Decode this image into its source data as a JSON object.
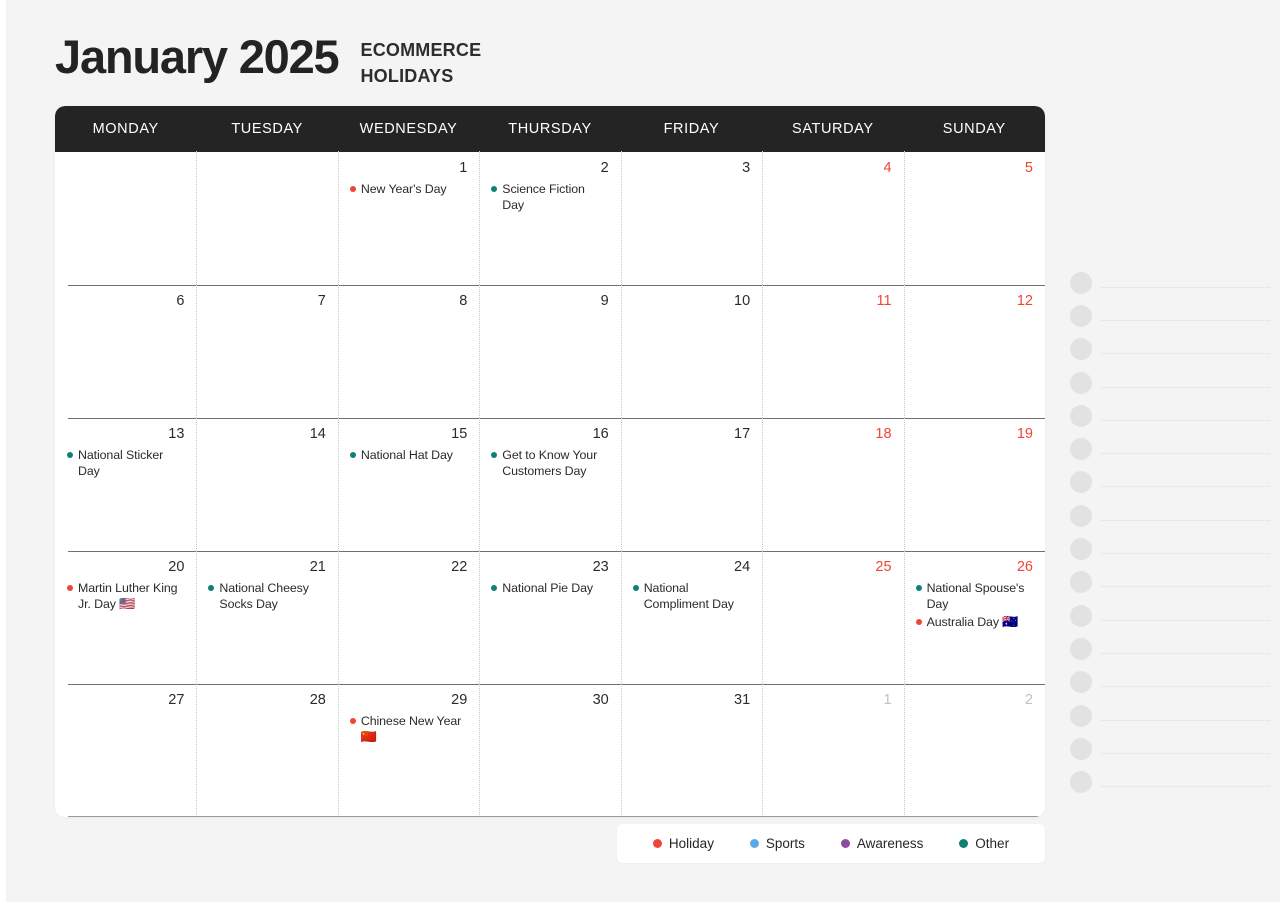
{
  "header": {
    "month_title": "January 2025",
    "subtitle_line1": "ECOMMERCE",
    "subtitle_line2": "HOLIDAYS"
  },
  "weekdays": [
    "MONDAY",
    "TUESDAY",
    "WEDNESDAY",
    "THURSDAY",
    "FRIDAY",
    "SATURDAY",
    "SUNDAY"
  ],
  "colors": {
    "holiday": "#f04438",
    "sports": "#5aa9e6",
    "awareness": "#8e4ca0",
    "other": "#0e8074",
    "header_bg": "#242424",
    "weekend_date": "#f04438",
    "other_month_date": "#c2c2c2",
    "page_bg": "#f4f4f4"
  },
  "legend": [
    {
      "label": "Holiday",
      "color": "#f04438"
    },
    {
      "label": "Sports",
      "color": "#5aa9e6"
    },
    {
      "label": "Awareness",
      "color": "#8e4ca0"
    },
    {
      "label": "Other",
      "color": "#0e8074"
    }
  ],
  "weeks": [
    [
      {
        "date": "",
        "kind": "empty",
        "events": []
      },
      {
        "date": "",
        "kind": "empty",
        "events": []
      },
      {
        "date": "1",
        "kind": "weekday",
        "events": [
          {
            "label": "New Year's Day",
            "category": "Holiday",
            "color": "#f04438",
            "emoji": ""
          }
        ]
      },
      {
        "date": "2",
        "kind": "weekday",
        "events": [
          {
            "label": "Science Fiction Day",
            "category": "Other",
            "color": "#0e8074",
            "emoji": ""
          }
        ]
      },
      {
        "date": "3",
        "kind": "weekday",
        "events": []
      },
      {
        "date": "4",
        "kind": "weekend",
        "events": []
      },
      {
        "date": "5",
        "kind": "weekend",
        "events": []
      }
    ],
    [
      {
        "date": "6",
        "kind": "weekday",
        "events": []
      },
      {
        "date": "7",
        "kind": "weekday",
        "events": []
      },
      {
        "date": "8",
        "kind": "weekday",
        "events": []
      },
      {
        "date": "9",
        "kind": "weekday",
        "events": []
      },
      {
        "date": "10",
        "kind": "weekday",
        "events": []
      },
      {
        "date": "11",
        "kind": "weekend",
        "events": []
      },
      {
        "date": "12",
        "kind": "weekend",
        "events": []
      }
    ],
    [
      {
        "date": "13",
        "kind": "weekday",
        "events": [
          {
            "label": "National Sticker Day",
            "category": "Other",
            "color": "#0e8074",
            "emoji": ""
          }
        ]
      },
      {
        "date": "14",
        "kind": "weekday",
        "events": []
      },
      {
        "date": "15",
        "kind": "weekday",
        "events": [
          {
            "label": "National Hat Day",
            "category": "Other",
            "color": "#0e8074",
            "emoji": ""
          }
        ]
      },
      {
        "date": "16",
        "kind": "weekday",
        "events": [
          {
            "label": "Get to Know Your Customers Day",
            "category": "Other",
            "color": "#0e8074",
            "emoji": ""
          }
        ]
      },
      {
        "date": "17",
        "kind": "weekday",
        "events": []
      },
      {
        "date": "18",
        "kind": "weekend",
        "events": []
      },
      {
        "date": "19",
        "kind": "weekend",
        "events": []
      }
    ],
    [
      {
        "date": "20",
        "kind": "weekday",
        "events": [
          {
            "label": "Martin Luther King Jr. Day",
            "category": "Holiday",
            "color": "#f04438",
            "emoji": "🇺🇸"
          }
        ]
      },
      {
        "date": "21",
        "kind": "weekday",
        "events": [
          {
            "label": "National Cheesy Socks Day",
            "category": "Other",
            "color": "#0e8074",
            "emoji": ""
          }
        ]
      },
      {
        "date": "22",
        "kind": "weekday",
        "events": []
      },
      {
        "date": "23",
        "kind": "weekday",
        "events": [
          {
            "label": "National Pie Day",
            "category": "Other",
            "color": "#0e8074",
            "emoji": ""
          }
        ]
      },
      {
        "date": "24",
        "kind": "weekday",
        "events": [
          {
            "label": "National Compliment Day",
            "category": "Other",
            "color": "#0e8074",
            "emoji": ""
          }
        ]
      },
      {
        "date": "25",
        "kind": "weekend",
        "events": []
      },
      {
        "date": "26",
        "kind": "weekend",
        "events": [
          {
            "label": "National Spouse's Day",
            "category": "Other",
            "color": "#0e8074",
            "emoji": ""
          },
          {
            "label": "Australia Day",
            "category": "Holiday",
            "color": "#f04438",
            "emoji": "🇦🇺"
          }
        ]
      }
    ],
    [
      {
        "date": "27",
        "kind": "weekday",
        "events": []
      },
      {
        "date": "28",
        "kind": "weekday",
        "events": []
      },
      {
        "date": "29",
        "kind": "weekday",
        "events": [
          {
            "label": "Chinese New Year",
            "category": "Holiday",
            "color": "#f04438",
            "emoji": "🇨🇳"
          }
        ]
      },
      {
        "date": "30",
        "kind": "weekday",
        "events": []
      },
      {
        "date": "31",
        "kind": "weekday",
        "events": []
      },
      {
        "date": "1",
        "kind": "other",
        "events": []
      },
      {
        "date": "2",
        "kind": "other",
        "events": []
      }
    ]
  ],
  "notes": {
    "line_count": 16
  }
}
